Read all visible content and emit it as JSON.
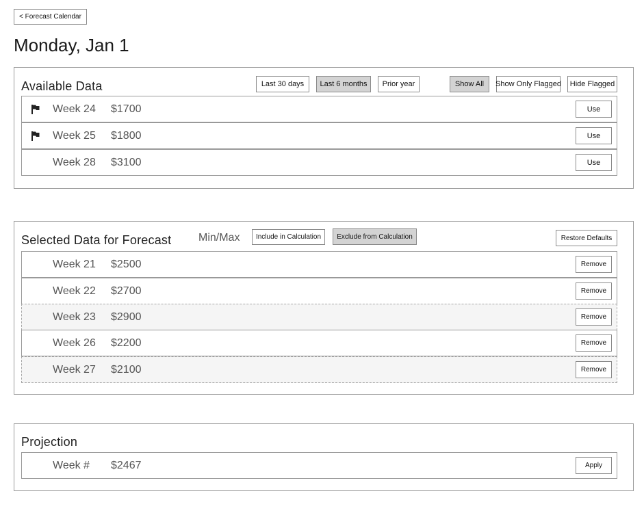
{
  "header": {
    "back_label": "< Forecast Calendar",
    "page_title": "Monday, Jan 1"
  },
  "available": {
    "title": "Available Data",
    "range_filters": [
      "Last 30 days",
      "Last 6 months",
      "Prior year"
    ],
    "active_range": "Last 6 months",
    "flag_filters": [
      "Show All",
      "Show Only Flagged",
      "Hide Flagged"
    ],
    "active_flag_filter": "Show All",
    "rows": [
      {
        "week": "Week 24",
        "amount": "$1700",
        "flagged": true,
        "action": "Use"
      },
      {
        "week": "Week 25",
        "amount": "$1800",
        "flagged": true,
        "action": "Use"
      },
      {
        "week": "Week 28",
        "amount": "$3100",
        "flagged": false,
        "action": "Use"
      }
    ]
  },
  "selected": {
    "title": "Selected Data for Forecast",
    "minmax_label": "Min/Max",
    "include_label": "Include in Calculation",
    "exclude_label": "Exclude from Calculation",
    "active_mode": "Exclude from Calculation",
    "restore_label": "Restore Defaults",
    "rows": [
      {
        "week": "Week 21",
        "amount": "$2500",
        "excluded": false,
        "action": "Remove"
      },
      {
        "week": "Week 22",
        "amount": "$2700",
        "excluded": false,
        "action": "Remove"
      },
      {
        "week": "Week 23",
        "amount": "$2900",
        "excluded": true,
        "action": "Remove"
      },
      {
        "week": "Week 26",
        "amount": "$2200",
        "excluded": false,
        "action": "Remove"
      },
      {
        "week": "Week 27",
        "amount": "$2100",
        "excluded": true,
        "action": "Remove"
      }
    ]
  },
  "projection": {
    "title": "Projection",
    "week": "Week #",
    "amount": "$2467",
    "apply_label": "Apply"
  },
  "colors": {
    "active_button": "#d3d3d3",
    "excluded_row_bg": "#f5f5f5"
  },
  "icons": {
    "flag": "flag-icon"
  }
}
